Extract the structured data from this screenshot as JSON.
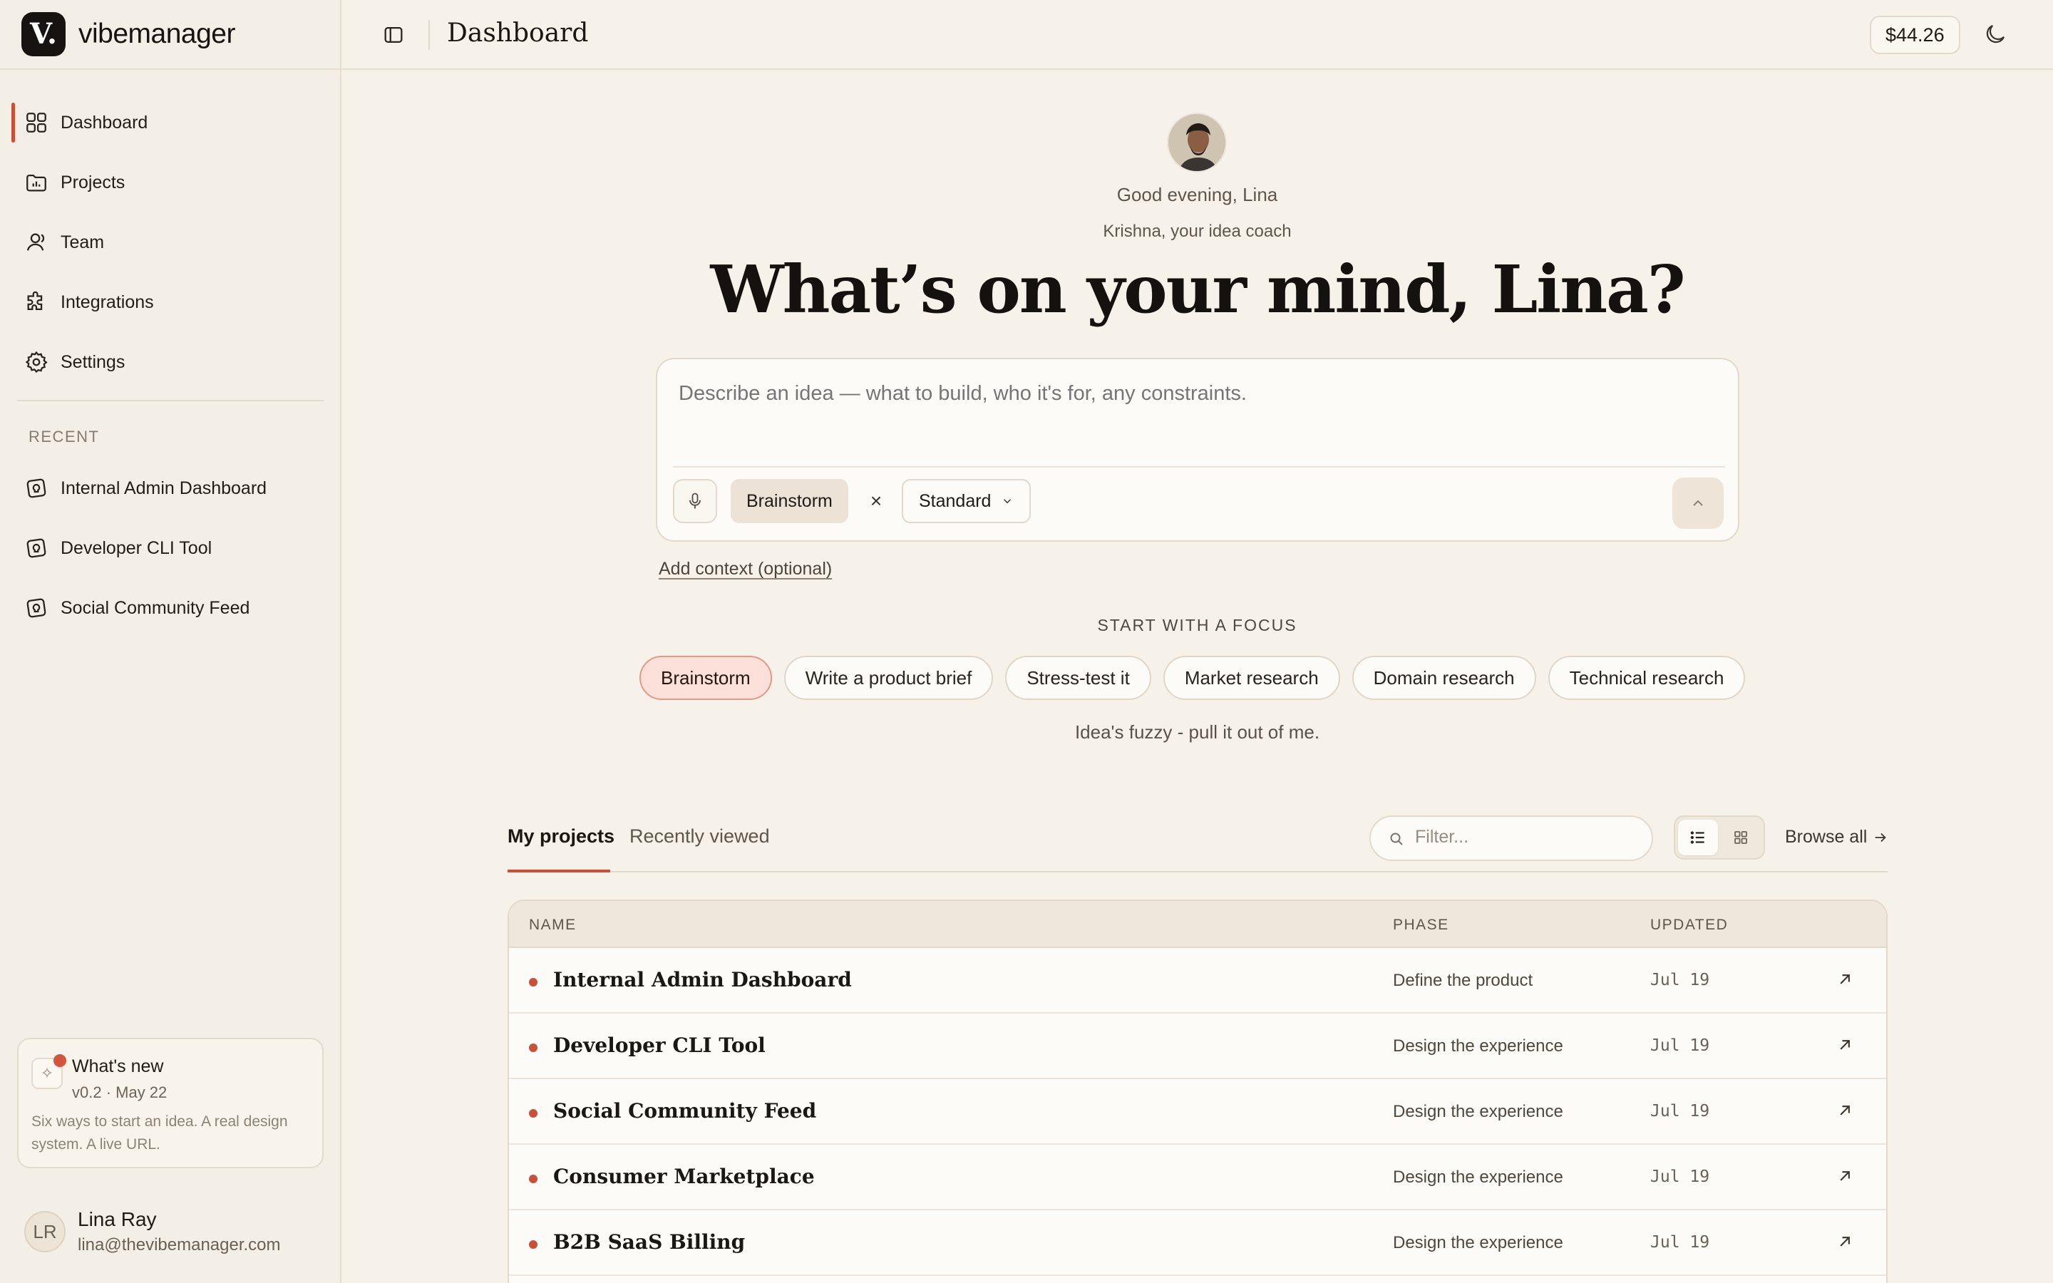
{
  "app": {
    "name": "vibemanager",
    "logo_letter": "V."
  },
  "sidebar": {
    "items": [
      {
        "label": "Dashboard",
        "icon": "grid-icon",
        "active": true
      },
      {
        "label": "Projects",
        "icon": "folder-chart-icon"
      },
      {
        "label": "Team",
        "icon": "user-icon"
      },
      {
        "label": "Integrations",
        "icon": "puzzle-icon"
      },
      {
        "label": "Settings",
        "icon": "gear-icon"
      }
    ],
    "recent_label": "RECENT",
    "recent": [
      {
        "label": "Internal Admin Dashboard"
      },
      {
        "label": "Developer CLI Tool"
      },
      {
        "label": "Social Community Feed"
      }
    ],
    "whats_new": {
      "title": "What's new",
      "version": "v0.2 · May 22",
      "description": "Six ways to start an idea. A real design system. A live URL."
    },
    "user": {
      "initials": "LR",
      "name": "Lina Ray",
      "email": "lina@thevibemanager.com"
    }
  },
  "header": {
    "title": "Dashboard",
    "credit": "$44.26"
  },
  "main": {
    "greeting": "Good evening, Lina",
    "coach": "Krishna, your idea coach",
    "hero": "What’s on your mind, Lina?",
    "composer": {
      "placeholder": "Describe an idea — what to build, who it's for, any constraints.",
      "mode": "Brainstorm",
      "depth": "Standard"
    },
    "add_context": "Add context (optional)",
    "focus_label": "START WITH A FOCUS",
    "focus_options": [
      {
        "label": "Brainstorm",
        "active": true
      },
      {
        "label": "Write a product brief"
      },
      {
        "label": "Stress-test it"
      },
      {
        "label": "Market research"
      },
      {
        "label": "Domain research"
      },
      {
        "label": "Technical research"
      }
    ],
    "focus_hint": "Idea's fuzzy - pull it out of me."
  },
  "projects": {
    "tabs": [
      {
        "label": "My projects",
        "active": true
      },
      {
        "label": "Recently viewed"
      }
    ],
    "filter_placeholder": "Filter...",
    "browse_all": "Browse all",
    "columns": {
      "name": "NAME",
      "phase": "PHASE",
      "updated": "UPDATED"
    },
    "rows": [
      {
        "name": "Internal Admin Dashboard",
        "phase": "Define the product",
        "updated": "Jul 19"
      },
      {
        "name": "Developer CLI Tool",
        "phase": "Design the experience",
        "updated": "Jul 19"
      },
      {
        "name": "Social Community Feed",
        "phase": "Design the experience",
        "updated": "Jul 19"
      },
      {
        "name": "Consumer Marketplace",
        "phase": "Design the experience",
        "updated": "Jul 19"
      },
      {
        "name": "B2B SaaS Billing",
        "phase": "Design the experience",
        "updated": "Jul 19"
      }
    ]
  },
  "colors": {
    "accent": "#c94f39",
    "background": "#f6f2ea",
    "sidebar": "#f4efe6"
  }
}
